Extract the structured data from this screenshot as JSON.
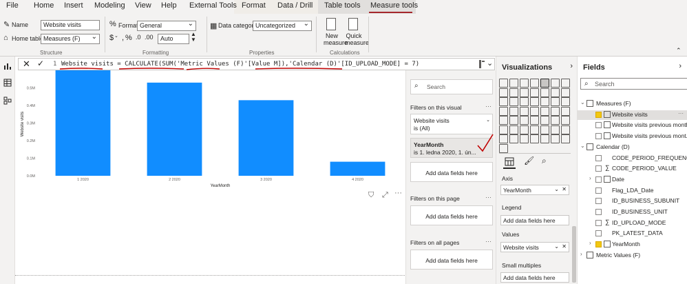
{
  "tabs": [
    "File",
    "Home",
    "Insert",
    "Modeling",
    "View",
    "Help",
    "External Tools",
    "Format",
    "Data / Drill",
    "Table tools",
    "Measure tools"
  ],
  "ribbon": {
    "name_label": "Name",
    "name_value": "Website visits",
    "home_table_label": "Home table",
    "home_table_value": "Measures (F)",
    "structure_group": "Structure",
    "format_label": "Format",
    "format_value": "General",
    "currency_symbol": "$",
    "decimal_value": "Auto",
    "formatting_group": "Formatting",
    "data_category_label": "Data category",
    "data_category_value": "Uncategorized",
    "properties_group": "Properties",
    "new_measure_label": "New measure",
    "quick_measure_label": "Quick measure",
    "calculations_group": "Calculations"
  },
  "formula": {
    "line_number": "1",
    "text": "Website visits = CALCULATE(SUM('Metric Values (F)'[Value M]),'Calendar (D)'[ID_UPLOAD_MODE] = 7)"
  },
  "chart_data": {
    "type": "bar",
    "categories": [
      "1 2020",
      "2 2020",
      "3 2020",
      "4 2020"
    ],
    "values": [
      0.61,
      0.53,
      0.43,
      0.08
    ],
    "ylabel": "Website visits",
    "xlabel": "YearMonth",
    "yticks": [
      "0.0M",
      "0.1M",
      "0.2M",
      "0.3M",
      "0.4M",
      "0.5M"
    ],
    "ylim": [
      0,
      0.6
    ],
    "bar_color": "#118dff"
  },
  "filters": {
    "search_placeholder": "Search",
    "on_visual": "Filters on this visual",
    "card1_title": "Website visits",
    "card1_sub": "is (All)",
    "card2_title": "YearMonth",
    "card2_sub": "is 1. ledna 2020, 1. ún...",
    "add_fields": "Add data fields here",
    "on_page": "Filters on this page",
    "on_all": "Filters on all pages"
  },
  "viz": {
    "title": "Visualizations",
    "axis_label": "Axis",
    "axis_value": "YearMonth",
    "legend_label": "Legend",
    "values_label": "Values",
    "values_value": "Website visits",
    "small_multiples_label": "Small multiples",
    "add_fields": "Add data fields here"
  },
  "fields": {
    "title": "Fields",
    "search_placeholder": "Search",
    "items": [
      {
        "name": "Measures (F)",
        "kind": "table"
      },
      {
        "name": "Website visits",
        "kind": "measure",
        "checked": true
      },
      {
        "name": "Website visits previous month",
        "kind": "measure"
      },
      {
        "name": "Website visits previous mont...",
        "kind": "measure"
      },
      {
        "name": "Calendar (D)",
        "kind": "table"
      },
      {
        "name": "CODE_PERIOD_FREQUENCY",
        "kind": "field"
      },
      {
        "name": "CODE_PERIOD_VALUE",
        "kind": "sum"
      },
      {
        "name": "Date",
        "kind": "date"
      },
      {
        "name": "Flag_LDA_Date",
        "kind": "field"
      },
      {
        "name": "ID_BUSINESS_SUBUNIT",
        "kind": "field"
      },
      {
        "name": "ID_BUSINESS_UNIT",
        "kind": "field"
      },
      {
        "name": "ID_UPLOAD_MODE",
        "kind": "sum"
      },
      {
        "name": "PK_LATEST_DATA",
        "kind": "field"
      },
      {
        "name": "YearMonth",
        "kind": "date",
        "checked": true
      },
      {
        "name": "Metric Values (F)",
        "kind": "table"
      }
    ]
  }
}
